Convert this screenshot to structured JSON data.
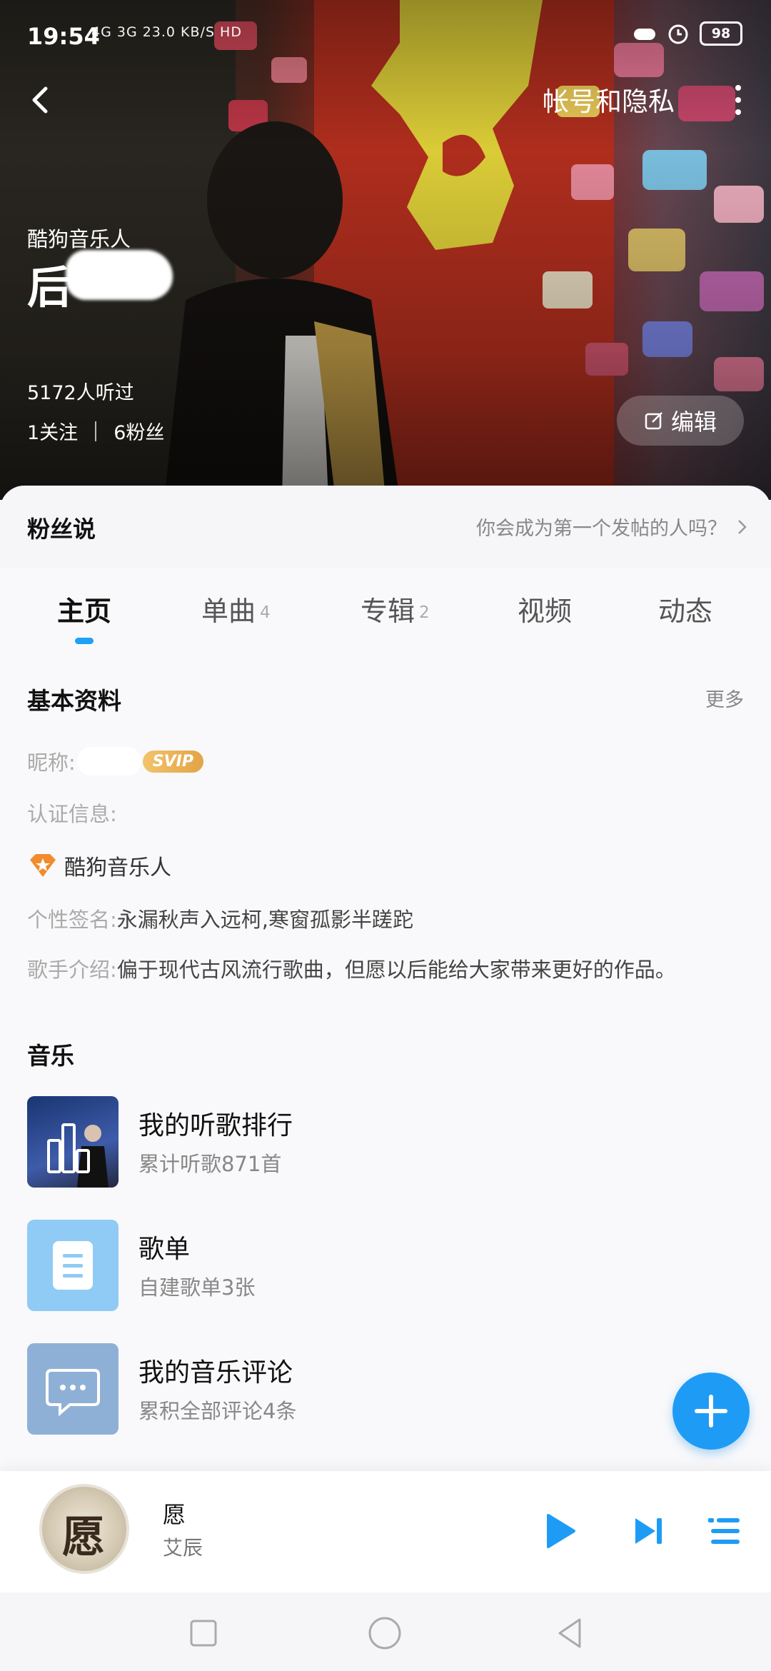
{
  "status_bar": {
    "time": "19:54",
    "network": "4G 3G 23.0 KB/S HD",
    "battery": "98"
  },
  "header": {
    "account_privacy": "帐号和隐私"
  },
  "profile": {
    "badge": "酷狗音乐人",
    "name_visible": "后",
    "listened": "5172人听过",
    "following": "1关注",
    "fans": "6粉丝",
    "edit_label": "编辑"
  },
  "fans_say": {
    "title": "粉丝说",
    "hint": "你会成为第一个发帖的人吗？"
  },
  "tabs": [
    {
      "label": "主页",
      "count": ""
    },
    {
      "label": "单曲",
      "count": "4"
    },
    {
      "label": "专辑",
      "count": "2"
    },
    {
      "label": "视频",
      "count": ""
    },
    {
      "label": "动态",
      "count": ""
    }
  ],
  "basic_info": {
    "title": "基本资料",
    "more": "更多",
    "nickname_label": "昵称:",
    "svip": "SVIP",
    "verify_label": "认证信息:",
    "verify_value": "酷狗音乐人",
    "signature_label": "个性签名:",
    "signature_value": "永漏秋声入远柯,寒窗孤影半蹉跎",
    "intro_label": "歌手介绍:",
    "intro_value": "偏于现代古风流行歌曲，但愿以后能给大家带来更好的作品。"
  },
  "music": {
    "title": "音乐",
    "items": [
      {
        "title": "我的听歌排行",
        "sub": "累计听歌871首",
        "icon": "bar-chart-icon"
      },
      {
        "title": "歌单",
        "sub": "自建歌单3张",
        "icon": "document-icon"
      },
      {
        "title": "我的音乐评论",
        "sub": "累积全部评论4条",
        "icon": "comment-icon"
      }
    ]
  },
  "player": {
    "song": "愿",
    "artist": "艾辰",
    "cover_glyph": "愿"
  },
  "colors": {
    "accent": "#1ea1f7",
    "svip_gold": "#e8b256",
    "verify_orange": "#f28b2c"
  }
}
